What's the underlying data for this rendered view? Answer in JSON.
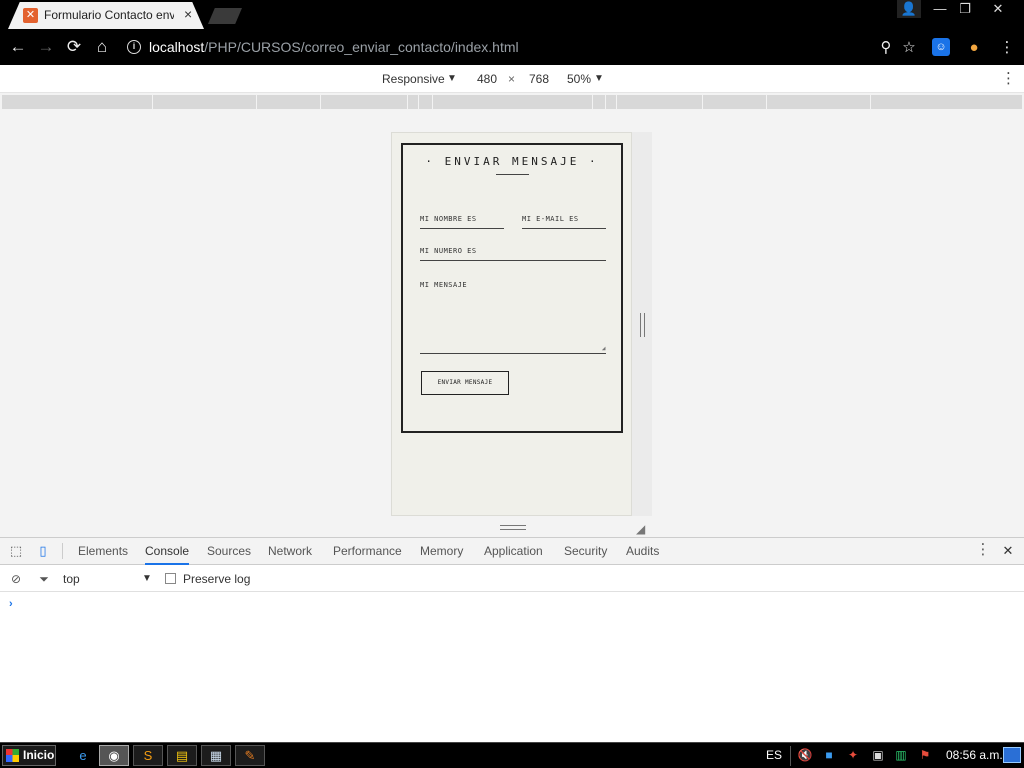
{
  "browser": {
    "tab": {
      "title": "Formulario Contacto enviar",
      "favicon": "xampp-icon",
      "close": "×"
    },
    "window": {
      "profile": "👤",
      "minimize": "—",
      "maximize": "❐",
      "close": "✕"
    },
    "toolbar": {
      "back": "←",
      "forward": "→",
      "reload": "⟳",
      "home": "⌂",
      "info": "i",
      "url_host": "localhost",
      "url_path": "/PHP/CURSOS/correo_enviar_contacto/index.html",
      "zoom": "⚲",
      "star": "☆",
      "ext1": "☺",
      "ext2": "●",
      "menu": "⋮"
    }
  },
  "device_toolbar": {
    "mode": "Responsive",
    "width": "480",
    "times": "×",
    "height": "768",
    "zoom": "50%",
    "caret": "▼",
    "more": "⋮"
  },
  "form": {
    "title": "· ENVIAR MENSAJE ·",
    "fields": {
      "nombre": "MI NOMBRE ES",
      "email": "MI E-MAIL ES",
      "telefono": "MI NUMERO ES",
      "mensaje": "MI MENSAJE"
    },
    "submit": "ENVIAR MENSAJE"
  },
  "devtools": {
    "tabs": [
      "Elements",
      "Console",
      "Sources",
      "Network",
      "Performance",
      "Memory",
      "Application",
      "Security",
      "Audits"
    ],
    "active_tab": "Console",
    "context": "top",
    "preserve_log": "Preserve log",
    "prompt": "›",
    "icons": {
      "inspect": "⬚",
      "device": "▯",
      "more": "⋮",
      "close": "✕",
      "clear": "⊘",
      "filter": "⏷"
    }
  },
  "taskbar": {
    "start": "Inicio",
    "language": "ES",
    "clock": "08:56 a.m.",
    "apps": [
      "internet-explorer",
      "chrome",
      "sublime-text",
      "file-explorer",
      "notepad",
      "paint"
    ]
  },
  "colors": {
    "accent": "#1a73e8",
    "page_bg": "#f0f0ea",
    "chrome_frame": "#000000"
  }
}
